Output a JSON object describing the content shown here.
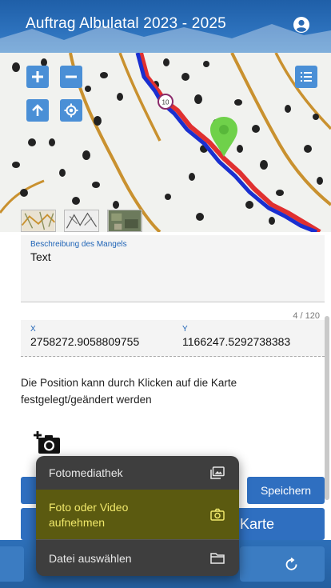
{
  "header": {
    "title": "Auftrag Albulatal 2023 - 2025"
  },
  "form": {
    "description_label": "Beschreibung des Mangels",
    "description_value": "Text",
    "counter": "4 / 120",
    "x_label": "X",
    "x_value": "2758272.9058809755",
    "y_label": "Y",
    "y_value": "1166247.5292738383",
    "hint": "Die Position kann durch Klicken auf die Karte festgelegt/geändert werden"
  },
  "buttons": {
    "save_label": "Speichern",
    "map_label": "Karte"
  },
  "menu": {
    "items": [
      {
        "label": "Fotomediathek",
        "icon": "gallery-icon"
      },
      {
        "label": "Foto oder Video aufnehmen",
        "icon": "camera-icon",
        "highlighted": true
      },
      {
        "label": "Datei auswählen",
        "icon": "folder-icon"
      }
    ]
  },
  "colors": {
    "brand_blue": "#2f6fc0",
    "route_blue": "#1a2fd0",
    "route_red": "#e03030",
    "marker_green": "#6fd14a",
    "menu_bg": "#3e3e3e",
    "menu_highlight": "#5b5a10",
    "label_blue": "#1e63b6"
  }
}
